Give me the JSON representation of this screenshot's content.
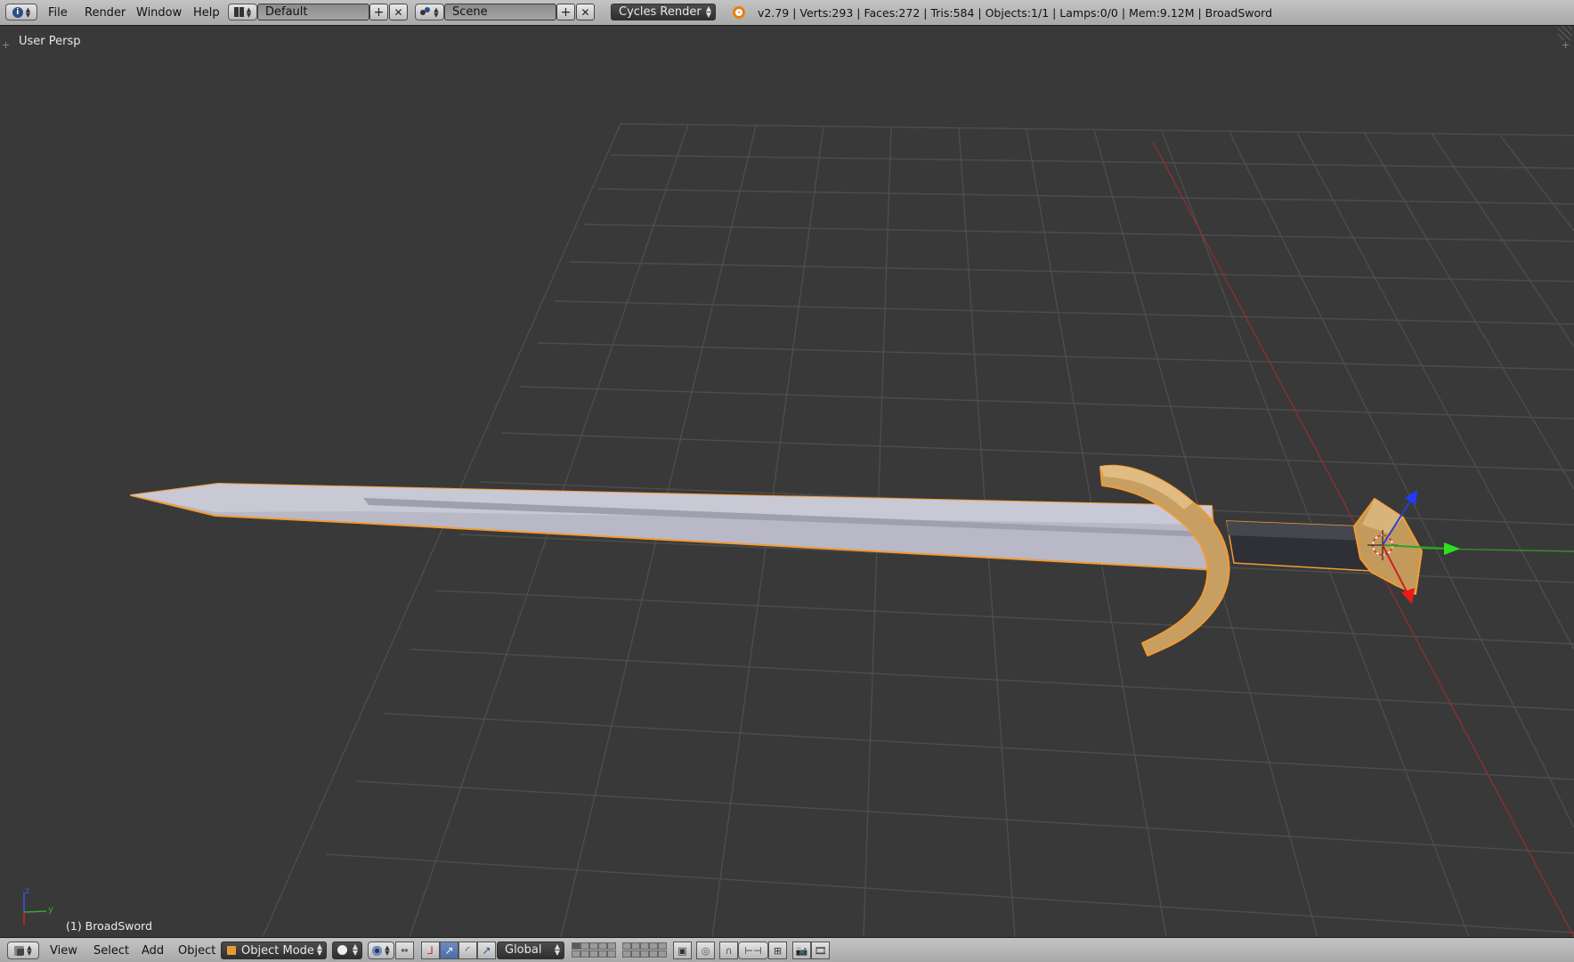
{
  "header": {
    "editor_icon": "info-icon",
    "menus": [
      "File",
      "Render",
      "Window",
      "Help"
    ],
    "screen_layout": {
      "icon": "screen-layout-icon",
      "value": "Default"
    },
    "scene": {
      "icon": "scene-icon",
      "value": "Scene"
    },
    "render_engine": "Cycles Render",
    "blender_logo_icon": "blender-logo-icon",
    "stats": "v2.79 | Verts:293 | Faces:272 | Tris:584 | Objects:1/1 | Lamps:0/0 | Mem:9.12M | BroadSword"
  },
  "viewport": {
    "view_label": "User Persp",
    "object_label": "(1) BroadSword",
    "mini_axes": {
      "z": "z",
      "y": "y"
    },
    "colors": {
      "background": "#393939",
      "grid": "#4d4d4d",
      "x_axis": "#8b3030",
      "y_axis": "#3b8b2e",
      "selection_outline": "#f39a33",
      "blade": "#b7b7c4",
      "gold": "#c9a268",
      "grip": "#2e2e35"
    }
  },
  "view3d_header": {
    "editor_icon": "view3d-icon",
    "menus": [
      "View",
      "Select",
      "Add",
      "Object"
    ],
    "mode": {
      "icon": "object-mode-icon",
      "value": "Object Mode"
    },
    "viewport_shading_icon": "solid-shading-icon",
    "pivot_icon": "pivot-point-icon",
    "manipulator_icons": [
      "manipulator-toggle-icon",
      "translate-icon",
      "rotate-icon",
      "scale-icon"
    ],
    "orientation": "Global",
    "extra_icons": [
      "layer-lock-icon",
      "proportional-edit-icon",
      "snap-icon",
      "snap-target-icon",
      "opengl-render-icon",
      "opengl-animation-icon"
    ]
  }
}
